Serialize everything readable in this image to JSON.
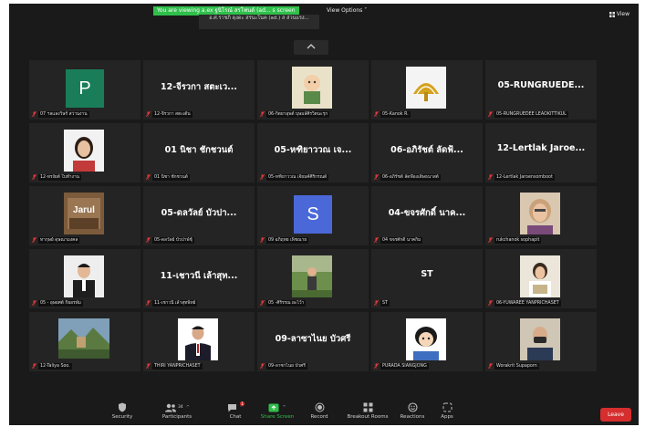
{
  "topbar": {
    "viewing_banner": "You are viewing a.ex ฐนิโรณ์ สรโฟนด์ (ad... s screen",
    "viewing_sub_line1": "อ.ศ.ราชภิ ดุงดะ สรนะโนค (ad.) ส ส่วนแรง...",
    "view_options": "View Options ˅",
    "view": "View"
  },
  "grid": {
    "tiles": [
      {
        "kind": "avatar",
        "letter": "P",
        "bg": "#1a7d5a",
        "label": "07 ฯลแลงวิษร์ สว่านงาน"
      },
      {
        "kind": "name",
        "display": "12-จีรวกา สตะเว...",
        "label": "12-จีรวกา สตะเต้น"
      },
      {
        "kind": "photo",
        "photo": "cartoon",
        "label": "06-กิตยาอุพต์ บุษมล์ศิรวิตนะรุก"
      },
      {
        "kind": "photo",
        "photo": "logo",
        "label": "05-Kanok R."
      },
      {
        "kind": "name",
        "display": "05-RUNGRUEDE...",
        "label": "05-RUNGRUEDEE LEAOKITTIKUL"
      },
      {
        "kind": "photo",
        "photo": "woman",
        "label": "12-ทรงัยต์ ใบทำงาน"
      },
      {
        "kind": "name",
        "display": "01 นิชา ชักชวนต์",
        "label": "01 นิชา ชักชวนต์"
      },
      {
        "kind": "name",
        "display": "05-หฑิยาววณ เจ...",
        "label": "05-หฑิยาววณ เจ้ยมค์ศิริกรณต์"
      },
      {
        "kind": "name",
        "display": "06-อภิรัชต์ ลัดฟ้...",
        "label": "06-อภิรัชต์ ลัดฟ้องเดิษธนาสต์"
      },
      {
        "kind": "name",
        "display": "12-Lertlak Jaroe...",
        "label": "12-Lertlak Jaroensomboot"
      },
      {
        "kind": "photo",
        "photo": "jarul",
        "label": "ทากุษย์ ดุษณามงคล"
      },
      {
        "kind": "name",
        "display": "05-ดลวัลย์ บัวปา...",
        "label": "05-ดลวัลย์ บัวปาพ์ชุ์"
      },
      {
        "kind": "avatar",
        "letter": "S",
        "bg": "#4a68d8",
        "label": "09 อภิฤทย เพ็ชณาย"
      },
      {
        "kind": "name",
        "display": "04-ขจรศักดิ์ นาค...",
        "label": "04 ขจรศักดิ์ นาคกิม"
      },
      {
        "kind": "photo",
        "photo": "oldwoman",
        "label": "rukchanok sophapit"
      },
      {
        "kind": "photo",
        "photo": "man",
        "label": "05 - อุษยศต์ ก็ยอรพัม"
      },
      {
        "kind": "name",
        "display": "11-เชาวนี เล้าสุท...",
        "label": "11-เชาวนี เล้าสุทพิทย์"
      },
      {
        "kind": "photo",
        "photo": "outdoor",
        "label": "05 -ศิริรรณ ผะไว้า"
      },
      {
        "kind": "name",
        "display": "ST",
        "label": "ST"
      },
      {
        "kind": "photo",
        "photo": "reader",
        "label": "06-YUWAREE YANPRICHASET"
      },
      {
        "kind": "photo",
        "photo": "landscape",
        "label": "12-Taliya Soo."
      },
      {
        "kind": "photo",
        "photo": "suitman",
        "label": "THIRI YANPRICHASET"
      },
      {
        "kind": "name",
        "display": "09-ลาซาไนย บัวศรี",
        "label": "09-ลาซาไนย บัวศรี"
      },
      {
        "kind": "photo",
        "photo": "cartoon2",
        "label": "PURADA SIANGJONG"
      },
      {
        "kind": "photo",
        "photo": "maskman",
        "label": "Worakrit Supaporn"
      }
    ]
  },
  "toolbar": {
    "security": "Security",
    "participants": "Participants",
    "participants_count": "34",
    "chat": "Chat",
    "chat_badge": "1",
    "share_screen": "Share Screen",
    "record": "Record",
    "breakout_rooms": "Breakout Rooms",
    "reactions": "Reactions",
    "apps": "Apps",
    "leave": "Leave"
  },
  "colors": {
    "background": "#1a1a1a",
    "tile": "#242424",
    "green_accent": "#2fbf4a",
    "leave_red": "#d62e2e",
    "mute_red": "#e23c3c"
  }
}
